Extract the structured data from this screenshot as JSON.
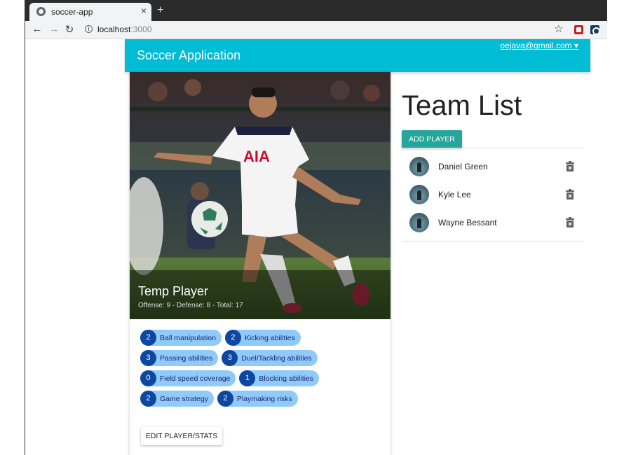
{
  "browser": {
    "tab_title": "soccer-app",
    "tab_close": "×",
    "new_tab": "+",
    "url_host": "localhost",
    "url_port": ":3000",
    "icons": {
      "back": "arrow-left-icon",
      "forward": "arrow-right-icon",
      "reload": "reload-icon",
      "site_info": "info-icon",
      "bookmark": "star-icon"
    }
  },
  "appbar": {
    "title": "Soccer Application",
    "user_menu": "oejava@gmail.com ▾",
    "color": "#00bcd4"
  },
  "player": {
    "name": "Temp Player",
    "stats_line": "Offense: 9 - Defense: 8 - Total: 17",
    "skills": [
      [
        {
          "value": "2",
          "label": "Ball manipulation"
        },
        {
          "value": "2",
          "label": "Kicking abilities"
        }
      ],
      [
        {
          "value": "3",
          "label": "Passing abilities"
        },
        {
          "value": "3",
          "label": "Duel/Tackling abilities"
        }
      ],
      [
        {
          "value": "0",
          "label": "Field speed coverage"
        },
        {
          "value": "1",
          "label": "Blocking abilities"
        }
      ],
      [
        {
          "value": "2",
          "label": "Game strategy"
        },
        {
          "value": "2",
          "label": "Playmaking risks"
        }
      ]
    ],
    "edit_button": "EDIT PLAYER/STATS",
    "chip_color": "#90caf9",
    "chip_number_color": "#0d47a1"
  },
  "team": {
    "title": "Team List",
    "add_button": "ADD PLAYER",
    "add_button_color": "#26a69a",
    "members": [
      {
        "name": "Daniel Green"
      },
      {
        "name": "Kyle Lee"
      },
      {
        "name": "Wayne Bessant"
      }
    ],
    "delete_icon": "trash-icon"
  }
}
